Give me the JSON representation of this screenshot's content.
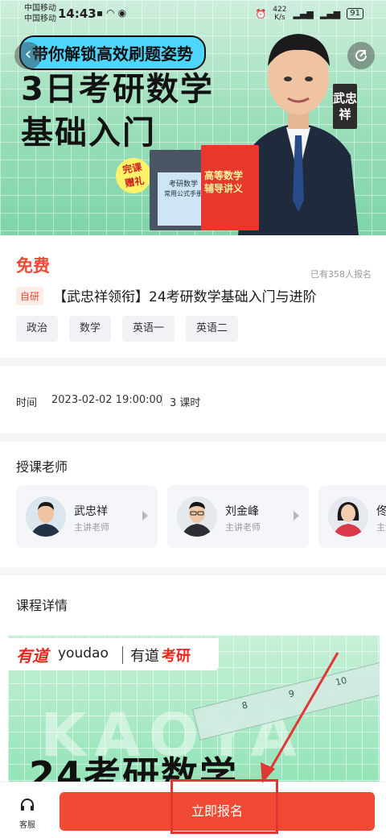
{
  "status_bar": {
    "carrier1": "中国移动",
    "carrier2": "中国移动",
    "time": "14:43",
    "net_speed_value": "422",
    "net_speed_unit": "K/s",
    "battery": "91"
  },
  "hero": {
    "tag": "带你解锁高效刷题姿势",
    "title_line1": "3日考研数学",
    "title_line2": "基础入门",
    "teacher_tag": "武忠祥",
    "gift_line1": "完课",
    "gift_line2": "赠礼",
    "book1_text1": "考研数学",
    "book1_text2": "常用公式手册",
    "book2_text1": "高等数学",
    "book2_text2": "辅导讲义"
  },
  "course": {
    "price": "免费",
    "enrolled": "已有358人报名",
    "badge": "自研",
    "title": "【武忠祥领衔】24考研数学基础入门与进阶",
    "tags": [
      "政治",
      "数学",
      "英语一",
      "英语二"
    ]
  },
  "schedule": {
    "label": "时间",
    "datetime": "2023-02-02 19:00:00",
    "lessons": "3 课时"
  },
  "teachers": {
    "section_title": "授课老师",
    "list": [
      {
        "name": "武忠祥",
        "role": "主讲老师"
      },
      {
        "name": "刘金峰",
        "role": "主讲老师"
      },
      {
        "name": "佟",
        "role": "主讲老师"
      }
    ]
  },
  "details": {
    "section_title": "课程详情",
    "logo_cn": "有道",
    "logo_en": "youdao",
    "logo_product_a": "有道",
    "logo_product_b": "考研",
    "watermark": "KAOYA",
    "ruler_n1": "8",
    "ruler_n2": "9",
    "ruler_n3": "10",
    "poster_title": "24考研数学"
  },
  "bottom_bar": {
    "service_label": "客服",
    "enroll_button": "立即报名"
  },
  "colors": {
    "accent": "#f04a34",
    "hero_green": "#9fe0bd",
    "annotation": "#e23636"
  },
  "icons": {
    "back": "back-arrow-icon",
    "share": "share-icon",
    "service": "headset-icon"
  }
}
